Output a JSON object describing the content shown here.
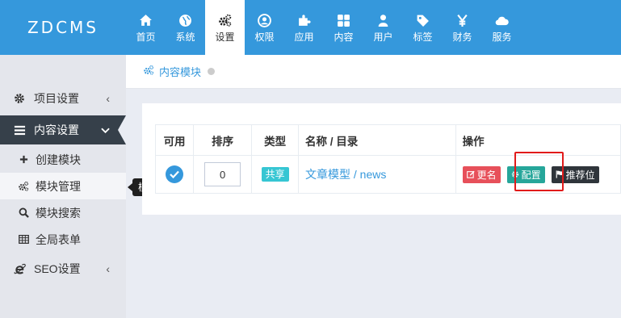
{
  "app": {
    "logo": "ZDCMS"
  },
  "nav": [
    {
      "label": "首页",
      "icon": "home-icon"
    },
    {
      "label": "系统",
      "icon": "globe-icon"
    },
    {
      "label": "设置",
      "icon": "cogs-icon",
      "active": true
    },
    {
      "label": "权限",
      "icon": "user-circle-icon"
    },
    {
      "label": "应用",
      "icon": "puzzle-icon"
    },
    {
      "label": "内容",
      "icon": "grid-icon"
    },
    {
      "label": "用户",
      "icon": "user-icon"
    },
    {
      "label": "标签",
      "icon": "tag-icon"
    },
    {
      "label": "财务",
      "icon": "yen-icon"
    },
    {
      "label": "服务",
      "icon": "cloud-icon"
    }
  ],
  "sidebar": {
    "project_settings": "项目设置",
    "content_settings": "内容设置",
    "sub_items": [
      {
        "label": "创建模块",
        "icon": "plus-icon"
      },
      {
        "label": "模块管理",
        "icon": "cogs-icon"
      },
      {
        "label": "模块搜索",
        "icon": "search-icon"
      },
      {
        "label": "全局表单",
        "icon": "table-icon"
      }
    ],
    "seo_settings": "SEO设置"
  },
  "tooltip": "模块管理",
  "breadcrumb": {
    "label": "内容模块"
  },
  "table": {
    "headers": {
      "enabled": "可用",
      "order": "排序",
      "type": "类型",
      "name": "名称 / 目录",
      "actions": "操作"
    },
    "rows": [
      {
        "enabled": true,
        "order": "0",
        "type": "共享",
        "name": "文章模型 / news",
        "actions": {
          "rename": "更名",
          "config": "配置",
          "recommend": "推荐位"
        }
      }
    ]
  },
  "colors": {
    "primary": "#3598dc",
    "sidebar_active": "#36404a",
    "rename": "#e7505a",
    "config": "#26a69a",
    "recommend": "#2f353b",
    "highlight": "#e11b1b"
  }
}
